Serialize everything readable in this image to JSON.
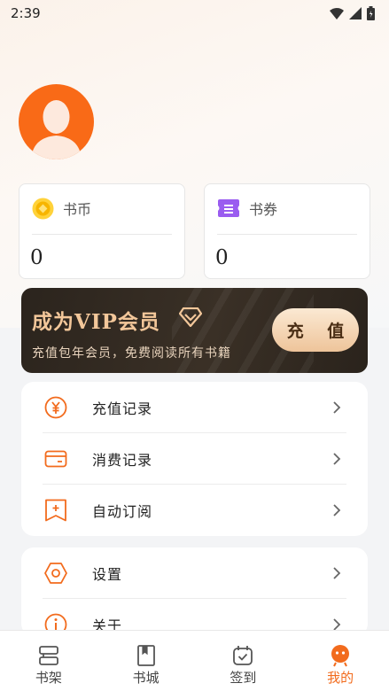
{
  "status_bar": {
    "time": "2:39",
    "icons": [
      "wifi-icon",
      "signal-icon",
      "battery-icon"
    ]
  },
  "profile": {
    "avatar": "default-avatar"
  },
  "wallet": [
    {
      "label": "书币",
      "value": "0",
      "icon": "coin-icon"
    },
    {
      "label": "书券",
      "value": "0",
      "icon": "ticket-icon"
    }
  ],
  "vip": {
    "title": "成为VIP会员",
    "description": "充值包年会员，免费阅读所有书籍",
    "button": "充 值",
    "colors": {
      "gold": "#f3c79a",
      "bg": "#2b241d"
    }
  },
  "menu_group_1": [
    {
      "label": "充值记录",
      "icon": "yen-icon"
    },
    {
      "label": "消费记录",
      "icon": "card-icon"
    },
    {
      "label": "自动订阅",
      "icon": "bookmark-plus-icon"
    }
  ],
  "menu_group_2": [
    {
      "label": "设置",
      "icon": "settings-icon"
    },
    {
      "label": "关于",
      "icon": "info-icon"
    }
  ],
  "tabbar": {
    "items": [
      {
        "label": "书架",
        "icon": "bookshelf-icon"
      },
      {
        "label": "书城",
        "icon": "book-icon"
      },
      {
        "label": "签到",
        "icon": "checkin-icon"
      },
      {
        "label": "我的",
        "icon": "mine-icon"
      }
    ],
    "active_index": 3,
    "accent": "#f26b1d"
  }
}
